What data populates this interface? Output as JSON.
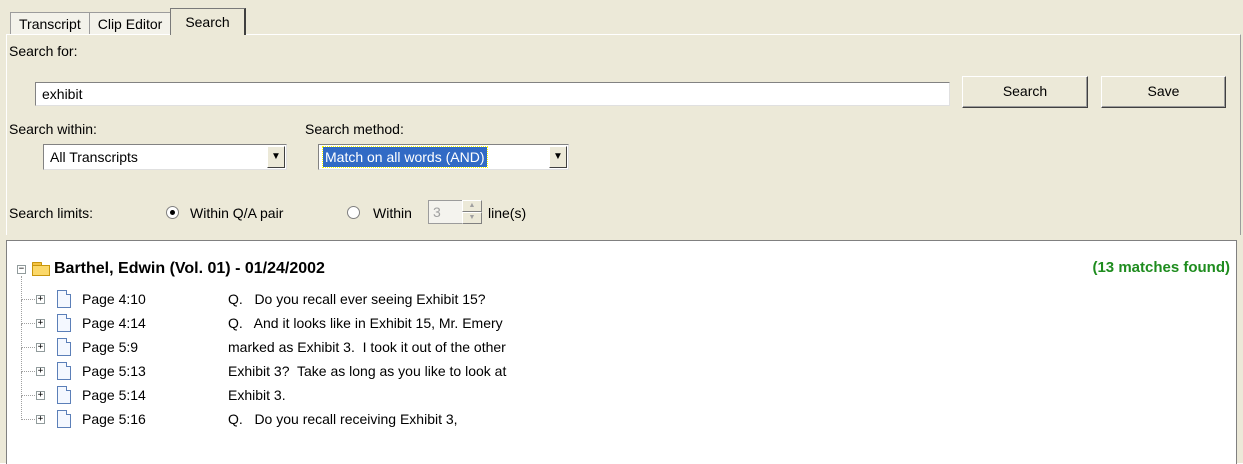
{
  "tabs": [
    {
      "label": "Transcript"
    },
    {
      "label": "Clip Editor"
    },
    {
      "label": "Search"
    }
  ],
  "search": {
    "label": "Search for:",
    "value": "exhibit",
    "search_button": "Search",
    "save_button": "Save"
  },
  "within": {
    "label": "Search within:",
    "selected": "All Transcripts"
  },
  "method": {
    "label": "Search method:",
    "selected": "Match on all words (AND)"
  },
  "limits": {
    "label": "Search limits:",
    "qa_label": "Within Q/A pair",
    "within_label": "Within",
    "lines_value": "3",
    "lines_suffix": "line(s)",
    "selected": "qa"
  },
  "results": {
    "title": "Barthel, Edwin (Vol. 01) - 01/24/2002",
    "matches": "(13 matches found)",
    "rows": [
      {
        "page": "Page 4:10",
        "text": "Q.   Do you recall ever seeing Exhibit 15?"
      },
      {
        "page": "Page 4:14",
        "text": "Q.   And it looks like in Exhibit 15, Mr. Emery"
      },
      {
        "page": "Page 5:9",
        "text": "marked as Exhibit 3.  I took it out of the other"
      },
      {
        "page": "Page 5:13",
        "text": "Exhibit 3?  Take as long as you like to look at"
      },
      {
        "page": "Page 5:14",
        "text": "Exhibit 3."
      },
      {
        "page": "Page 5:16",
        "text": "Q.   Do you recall receiving Exhibit 3,"
      }
    ]
  },
  "colors": {
    "matches": "#1e8c1e",
    "selection": "#316ac5",
    "panel": "#ece9d8"
  }
}
